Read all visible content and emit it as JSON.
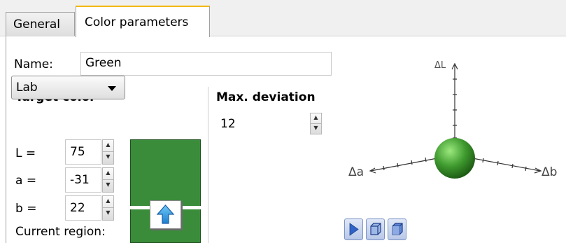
{
  "tabs": [
    {
      "label": "General",
      "active": false
    },
    {
      "label": "Color parameters",
      "active": true
    }
  ],
  "name_field": {
    "label": "Name:",
    "value": "Green"
  },
  "target_color": {
    "heading": "Target color",
    "mode": "Lab",
    "fields": [
      {
        "label": "L =",
        "value": "75"
      },
      {
        "label": "a =",
        "value": "-31"
      },
      {
        "label": "b =",
        "value": "22"
      }
    ],
    "current_region_label": "Current region:",
    "swatch_color": "#3a8c3a"
  },
  "max_deviation": {
    "heading": "Max. deviation",
    "value": "12"
  },
  "plot3d": {
    "axis_labels": {
      "up": "ΔL",
      "left": "Δa",
      "right": "Δb"
    },
    "sphere_color": "#3e9a2e"
  },
  "colors": {
    "tab_accent": "#f5b800",
    "view_button": "#3b6fcf"
  }
}
